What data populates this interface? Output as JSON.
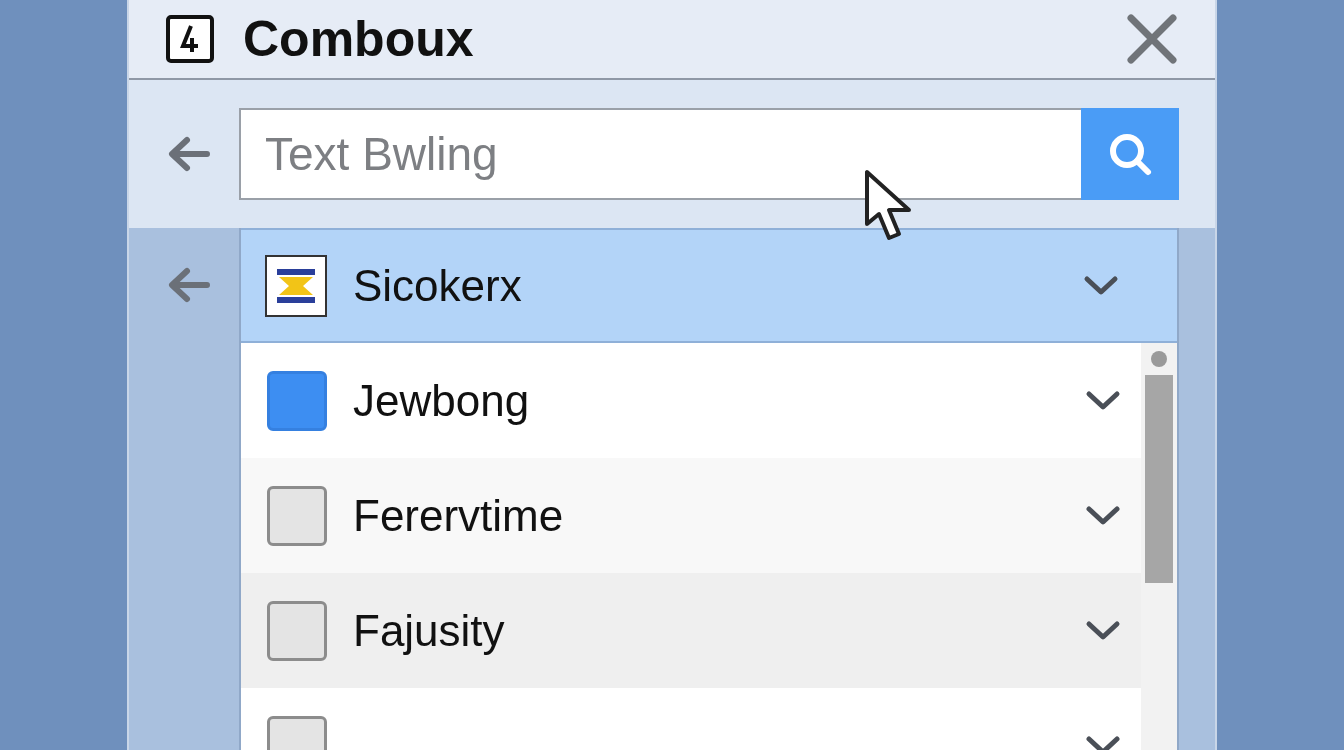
{
  "window": {
    "title": "Comboux"
  },
  "search": {
    "placeholder": "Text Bwling"
  },
  "combo": {
    "label": "Sicokerx",
    "selected": true
  },
  "items": [
    {
      "label": "Jewbong",
      "checked": true
    },
    {
      "label": "Ferervtime",
      "checked": false
    },
    {
      "label": "Fajusity",
      "checked": false
    },
    {
      "checked": false
    }
  ]
}
